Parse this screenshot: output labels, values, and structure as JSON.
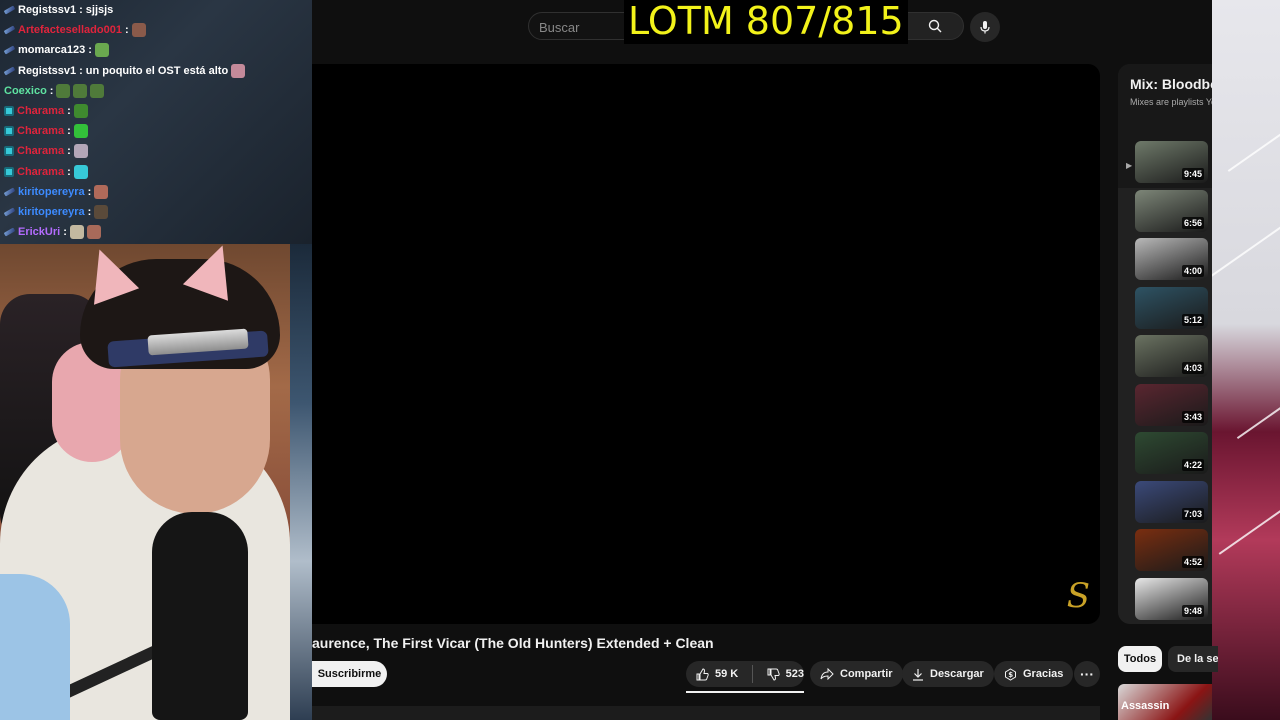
{
  "stream_overlay": {
    "counter_text": "LOTM 807/815"
  },
  "youtube": {
    "search_placeholder": "Buscar",
    "video_title": "aurence, The First Vicar (The Old Hunters) Extended + Clean",
    "subscribe_label": "Suscribirme",
    "likes": "59 K",
    "dislikes": "523",
    "share_label": "Compartir",
    "download_label": "Descargar",
    "thanks_label": "Gracias",
    "more_label": "···",
    "playlist": {
      "title": "Mix: Bloodbo",
      "subtitle": "Mixes are playlists Yo",
      "items": [
        {
          "duration": "9:45",
          "color": "#6f7a6a"
        },
        {
          "duration": "6:56",
          "color": "#7d8678"
        },
        {
          "duration": "4:00",
          "color": "#b9b9b9"
        },
        {
          "duration": "5:12",
          "color": "#2e5364"
        },
        {
          "duration": "4:03",
          "color": "#6b7362"
        },
        {
          "duration": "3:43",
          "color": "#5a2630"
        },
        {
          "duration": "4:22",
          "color": "#2e4a32"
        },
        {
          "duration": "7:03",
          "color": "#3b4a7a"
        },
        {
          "duration": "4:52",
          "color": "#7a2e10"
        },
        {
          "duration": "9:48",
          "color": "#e8e8e8"
        }
      ]
    },
    "chips": {
      "all": "Todos",
      "second": "De la se"
    },
    "recommendation_label": "Assassin"
  },
  "chat": [
    {
      "user": "Registssv1",
      "user_color": "#ffffff",
      "badge": "pen",
      "message": "sjjsjs",
      "emotes": []
    },
    {
      "user": "Artefactesellado001",
      "user_color": "#e0243c",
      "badge": "pen",
      "message": "",
      "emotes": [
        "#8a5a4a"
      ]
    },
    {
      "user": "momarca123",
      "user_color": "#ffffff",
      "badge": "pen",
      "message": "",
      "emotes": [
        "#6aa84f"
      ]
    },
    {
      "user": "Registssv1",
      "user_color": "#ffffff",
      "badge": "pen",
      "message": "un poquito el OST está alto",
      "emotes": [
        "#c48a9a"
      ]
    },
    {
      "user": "Coexico",
      "user_color": "#5fe3a1",
      "badge": "",
      "message": "",
      "emotes": [
        "#4f7a3a",
        "#4f7a3a",
        "#4f7a3a"
      ]
    },
    {
      "user": "Charama",
      "user_color": "#e0243c",
      "badge": "gift",
      "message": "",
      "emotes": [
        "#3f8a2f"
      ]
    },
    {
      "user": "Charama",
      "user_color": "#e0243c",
      "badge": "gift",
      "message": "",
      "emotes": [
        "#33c13a"
      ]
    },
    {
      "user": "Charama",
      "user_color": "#e0243c",
      "badge": "gift",
      "message": "",
      "emotes": [
        "#b3a6b8"
      ]
    },
    {
      "user": "Charama",
      "user_color": "#e0243c",
      "badge": "gift",
      "message": "",
      "emotes": [
        "#37c9d8"
      ]
    },
    {
      "user": "kiritopereyra",
      "user_color": "#3d8bff",
      "badge": "pen",
      "message": "",
      "emotes": [
        "#b06a5a"
      ]
    },
    {
      "user": "kiritopereyra",
      "user_color": "#3d8bff",
      "badge": "pen",
      "message": "",
      "emotes": [
        "#5a4a3a"
      ]
    },
    {
      "user": "ErickUri",
      "user_color": "#b46cff",
      "badge": "pen",
      "message": "",
      "emotes": [
        "#c2b8a0",
        "#a86a5a"
      ]
    }
  ]
}
